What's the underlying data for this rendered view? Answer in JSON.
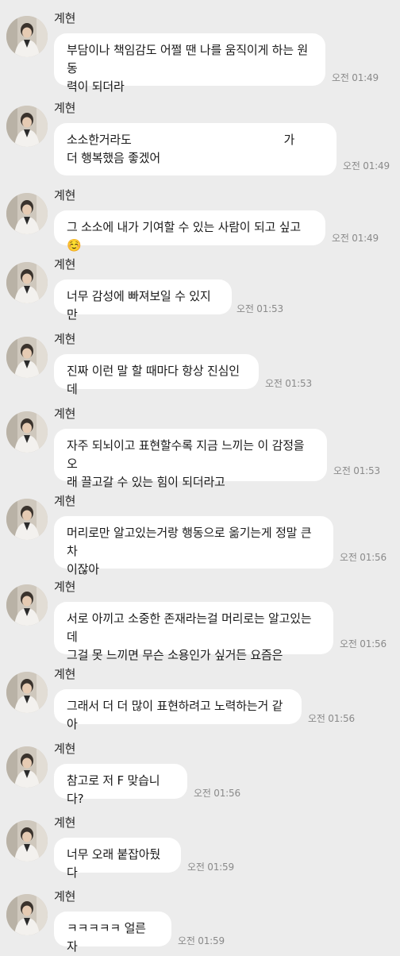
{
  "messages": [
    {
      "sender": "계현",
      "text": "부담이나 책임감도 어쩔 땐 나를 움직이게 하는 원동\n력이 되더라",
      "time": "오전 01:49"
    },
    {
      "sender": "계현",
      "text": "소소한거라도                                          가\n더 행복했음 좋겠어",
      "time": "오전 01:49"
    },
    {
      "sender": "계현",
      "text": "그 소소에 내가 기여할 수 있는 사람이 되고 싶고☺️",
      "time": "오전 01:49"
    },
    {
      "sender": "계현",
      "text": "너무 감성에 빠져보일 수 있지만",
      "time": "오전 01:53"
    },
    {
      "sender": "계현",
      "text": "진짜 이런 말 할 때마다 항상 진심인데",
      "time": "오전 01:53"
    },
    {
      "sender": "계현",
      "text": "자주 되뇌이고 표현할수록 지금 느끼는 이 감정을 오\n래 끌고갈 수 있는 힘이 되더라고",
      "time": "오전 01:53"
    },
    {
      "sender": "계현",
      "text": "머리로만 알고있는거랑 행동으로 옮기는게 정말 큰 차\n이잖아",
      "time": "오전 01:56"
    },
    {
      "sender": "계현",
      "text": "서로 아끼고 소중한 존재라는걸 머리로는 알고있는데\n그걸 못 느끼면 무슨 소용인가 싶거든 요즘은",
      "time": "오전 01:56"
    },
    {
      "sender": "계현",
      "text": "그래서 더 더 많이 표현하려고 노력하는거 같아",
      "time": "오전 01:56"
    },
    {
      "sender": "계현",
      "text": "참고로 저 F 맞습니다?",
      "time": "오전 01:56"
    },
    {
      "sender": "계현",
      "text": "너무 오래 붙잡아뒀다",
      "time": "오전 01:59"
    },
    {
      "sender": "계현",
      "text": "ㅋㅋㅋㅋㅋ 얼른 자",
      "time": "오전 01:59"
    }
  ]
}
